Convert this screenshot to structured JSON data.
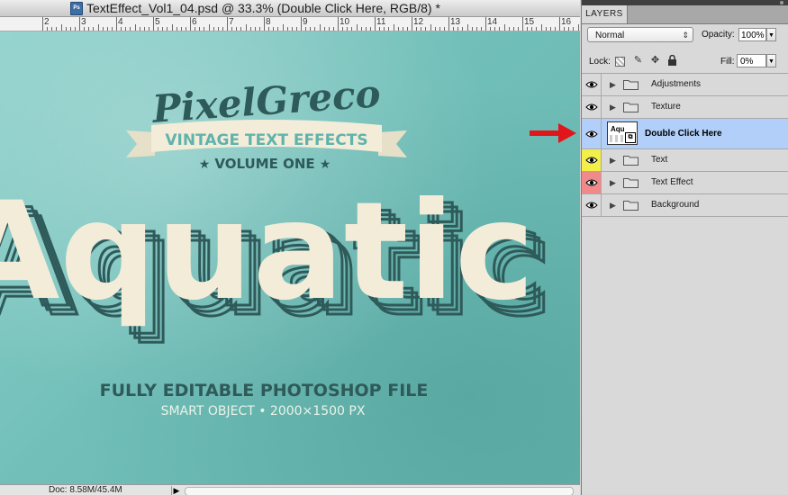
{
  "document": {
    "title": "TextEffect_Vol1_04.psd @ 33.3% (Double Click Here, RGB/8) *",
    "file_icon": "photoshop-file-icon",
    "ruler_numbers": [
      "2",
      "3",
      "4",
      "5",
      "6",
      "7",
      "8",
      "9",
      "10",
      "11",
      "12",
      "13",
      "14",
      "15",
      "16"
    ],
    "canvas": {
      "brand": "PixelGreco",
      "banner": "VINTAGE TEXT EFFECTS",
      "volume": "VOLUME ONE",
      "headline": "Aquatic",
      "tagline": "FULLY EDITABLE PHOTOSHOP FILE",
      "subtagline": "SMART OBJECT • 2000×1500 PX",
      "colors": {
        "background": "#76c2bd",
        "dark_text": "#2f5a5a",
        "cream": "#f3ecd9",
        "subtitle": "#eaf3e8"
      }
    },
    "status": {
      "doc_size": "Doc: 8.58M/45.4M",
      "arrow_icon": "play-arrow-icon"
    }
  },
  "layers_panel": {
    "tab_label": "LAYERS",
    "blend_mode": "Normal",
    "opacity_label": "Opacity:",
    "opacity_value": "100%",
    "lock_label": "Lock:",
    "fill_label": "Fill:",
    "fill_value": "0%",
    "lock_icons": [
      "lock-transparent-icon",
      "brush-icon",
      "move-icon",
      "lock-icon"
    ],
    "layers": [
      {
        "name": "Adjustments",
        "type": "group",
        "eye_color": "#d9d9d9",
        "selected": false
      },
      {
        "name": "Texture",
        "type": "group",
        "eye_color": "#d9d9d9",
        "selected": false
      },
      {
        "name": "Double Click Here",
        "type": "smart-object",
        "thumb_text": "Aqu",
        "eye_color": "#b1cff8",
        "selected": true
      },
      {
        "name": "Text",
        "type": "group",
        "eye_color": "#f2ef4a",
        "selected": false
      },
      {
        "name": "Text Effect",
        "type": "group",
        "eye_color": "#f08a8a",
        "selected": false
      },
      {
        "name": "Background",
        "type": "group",
        "eye_color": "#d9d9d9",
        "selected": false
      }
    ],
    "pointer_arrow_color": "#e0161b"
  }
}
